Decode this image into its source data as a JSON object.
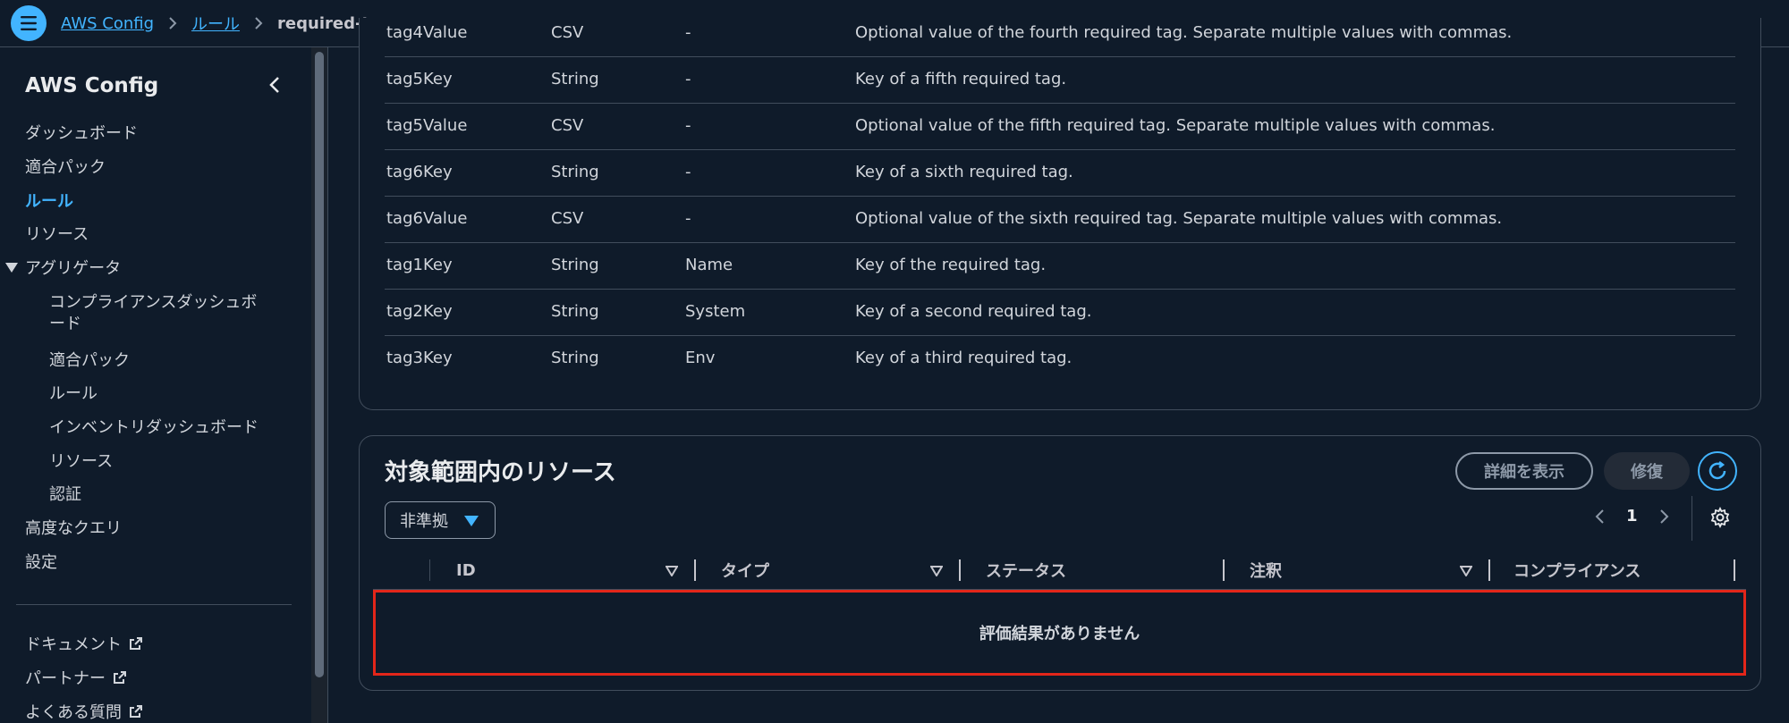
{
  "breadcrumb": {
    "home": "AWS Config",
    "rules": "ルール",
    "current": "required-tags"
  },
  "sidebar": {
    "title": "AWS Config",
    "items": [
      {
        "label": "ダッシュボード"
      },
      {
        "label": "適合パック"
      },
      {
        "label": "ルール",
        "active": true
      },
      {
        "label": "リソース"
      },
      {
        "label": "アグリゲータ"
      },
      {
        "label": "コンプライアンスダッシュボ"
      },
      {
        "label": "ード"
      },
      {
        "label": "適合パック"
      },
      {
        "label": "ルール"
      },
      {
        "label": "インベントリダッシュボード"
      },
      {
        "label": "リソース"
      },
      {
        "label": "認証"
      },
      {
        "label": "高度なクエリ"
      },
      {
        "label": "設定"
      }
    ],
    "links": [
      {
        "label": "ドキュメント"
      },
      {
        "label": "パートナー"
      },
      {
        "label": "よくある質問"
      }
    ]
  },
  "parameters": [
    {
      "key": "tag4Value",
      "type": "CSV",
      "value": "-",
      "description": "Optional value of the fourth required tag. Separate multiple values with commas."
    },
    {
      "key": "tag5Key",
      "type": "String",
      "value": "-",
      "description": "Key of a fifth required tag."
    },
    {
      "key": "tag5Value",
      "type": "CSV",
      "value": "-",
      "description": "Optional value of the fifth required tag. Separate multiple values with commas."
    },
    {
      "key": "tag6Key",
      "type": "String",
      "value": "-",
      "description": "Key of a sixth required tag."
    },
    {
      "key": "tag6Value",
      "type": "CSV",
      "value": "-",
      "description": "Optional value of the sixth required tag. Separate multiple values with commas."
    },
    {
      "key": "tag1Key",
      "type": "String",
      "value": "Name",
      "description": "Key of the required tag."
    },
    {
      "key": "tag2Key",
      "type": "String",
      "value": "System",
      "description": "Key of a second required tag."
    },
    {
      "key": "tag3Key",
      "type": "String",
      "value": "Env",
      "description": "Key of a third required tag."
    }
  ],
  "resources": {
    "title": "対象範囲内のリソース",
    "details_button": "詳細を表示",
    "remediate_button": "修復",
    "filter_value": "非準拠",
    "page": "1",
    "columns": {
      "id": "ID",
      "type": "タイプ",
      "status": "ステータス",
      "annotation": "注釈",
      "compliance": "コンプライアンス"
    },
    "empty_message": "評価結果がありません"
  },
  "colors": {
    "accent": "#42b4ff",
    "background": "#0f1b2a",
    "highlight": "#e3261a"
  }
}
